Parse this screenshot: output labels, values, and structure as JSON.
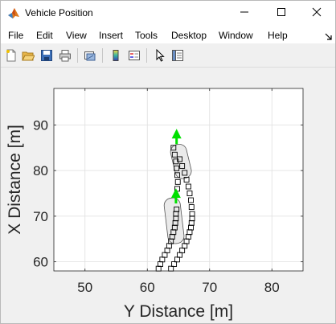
{
  "window": {
    "title": "Vehicle Position",
    "controls": [
      "minimize-icon",
      "maximize-icon",
      "close-icon"
    ]
  },
  "menu": [
    {
      "label": "File"
    },
    {
      "label": "Edit"
    },
    {
      "label": "View"
    },
    {
      "label": "Insert"
    },
    {
      "label": "Tools"
    },
    {
      "label": "Desktop"
    },
    {
      "label": "Window"
    },
    {
      "label": "Help"
    }
  ],
  "toolbar": {
    "buttons": [
      "new-figure-icon",
      "open-file-icon",
      "save-icon",
      "print-icon",
      "link-plot-icon",
      "colorbar-icon",
      "legend-icon",
      "pointer-icon",
      "property-inspector-icon"
    ]
  },
  "colors": {
    "marker_edge": "#000000",
    "arrow": "#00e000",
    "vehicle_outline": "#555555",
    "vehicle_fill": "#d8d8d8"
  },
  "chart_data": {
    "type": "scatter",
    "xlabel": "Y Distance [m]",
    "ylabel": "X Distance [m]",
    "xlim": [
      45,
      85
    ],
    "ylim": [
      58,
      98
    ],
    "xticks": [
      50,
      60,
      70,
      80
    ],
    "yticks": [
      60,
      70,
      80,
      90
    ],
    "grid": true,
    "series": [
      {
        "marker": "square",
        "x": [
          61.8,
          62.1,
          62.4,
          62.8,
          63.2,
          63.5,
          63.8,
          64.0,
          64.2,
          64.4,
          64.5,
          64.6,
          64.6,
          64.7,
          64.8,
          64.9,
          64.8,
          64.7,
          64.6,
          64.4,
          64.2
        ],
        "y": [
          58.5,
          59.5,
          60.5,
          61.5,
          62.5,
          63.5,
          64.5,
          65.5,
          66.5,
          67.5,
          68.5,
          69.5,
          70.5,
          71.5,
          76.0,
          77.5,
          79.0,
          80.5,
          82.0,
          83.5,
          85.0
        ]
      },
      {
        "marker": "square",
        "x": [
          63.8,
          64.3,
          64.8,
          65.2,
          65.6,
          66.0,
          66.3,
          66.6,
          66.8,
          67.0,
          67.1,
          67.2,
          67.2,
          67.1,
          67.0,
          66.8,
          66.6,
          66.3,
          66.0,
          65.6,
          65.2
        ],
        "y": [
          58.5,
          59.5,
          60.5,
          61.5,
          62.5,
          63.5,
          64.5,
          65.5,
          66.5,
          67.5,
          68.5,
          69.5,
          70.5,
          72.0,
          73.5,
          75.0,
          76.5,
          78.0,
          79.5,
          81.0,
          82.5
        ]
      }
    ],
    "vehicles": [
      {
        "center": [
          64.3,
          69.0
        ],
        "heading_deg": 95,
        "length": 10,
        "width": 2.6
      },
      {
        "center": [
          65.4,
          82.0
        ],
        "heading_deg": 100,
        "length": 7.5,
        "width": 2.6
      }
    ],
    "arrows": [
      {
        "x": 64.6,
        "y": 74.2
      },
      {
        "x": 64.7,
        "y": 87.2
      }
    ]
  }
}
